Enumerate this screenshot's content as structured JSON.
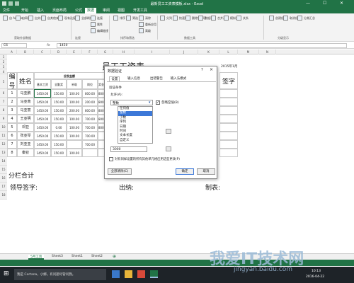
{
  "window": {
    "title": "最新员工工资表模板.xlsx - Excel"
  },
  "menu_tabs": [
    "文件",
    "开始",
    "插入",
    "页面布局",
    "公式",
    "数据",
    "审阅",
    "视图",
    "开发工具"
  ],
  "active_tab_index": 5,
  "ribbon": {
    "buttons": [
      "自 Access",
      "自网站",
      "自文本",
      "自其他来源",
      "现有连接",
      "全部刷新",
      "连接",
      "属性",
      "编辑链接",
      "排序",
      "筛选",
      "清除",
      "重新应用",
      "高级",
      "分列",
      "快速填充",
      "删除重复项",
      "数据验证",
      "合并计算",
      "模拟分析",
      "关系",
      "创建组",
      "取消组合",
      "分类汇总"
    ],
    "groups": [
      "获取外部数据",
      "连接",
      "排序和筛选",
      "数据工具",
      "分级显示"
    ]
  },
  "formula_bar": {
    "name_box": "C6",
    "fx": "fx",
    "value": "1450"
  },
  "columns": [
    "A",
    "B",
    "C",
    "D",
    "E",
    "F",
    "G",
    "H",
    "I",
    "J",
    "K",
    "L",
    "M",
    "N"
  ],
  "rows": [
    "1",
    "2",
    "3",
    "4",
    "5",
    "6",
    "7",
    "8",
    "9",
    "10",
    "11",
    "12",
    "13",
    "14",
    "15",
    "16",
    "17",
    "18"
  ],
  "sheet": {
    "title": "员工工资表",
    "date": "2015年1月",
    "header_num": "编号",
    "header_name": "姓名",
    "header_group": "应发金额",
    "header_sign": "签字",
    "sub_headers": [
      "基本工资",
      "全勤奖",
      "补助",
      "岗位",
      "奖金"
    ],
    "nums": [
      "1",
      "2",
      "3",
      "4",
      "5",
      "6",
      "7",
      "8"
    ],
    "names": [
      "马亚鹏",
      "马亚南",
      "马亚丽",
      "王亚明",
      "邓亚",
      "张亚琴",
      "刘亚亚",
      "秦亚"
    ],
    "rows": [
      [
        "1450.00",
        "150.00",
        "100.00",
        "800.00",
        "800.00"
      ],
      [
        "1450.00",
        "150.00",
        "100.00",
        "200.00",
        "800.00"
      ],
      [
        "1450.00",
        "150.00",
        "200.00",
        "800.00",
        "800.00"
      ],
      [
        "1450.00",
        "150.00",
        "100.00",
        "700.00",
        "800.00"
      ],
      [
        "1450.00",
        "0.00",
        "100.00",
        "700.00",
        "800.00"
      ],
      [
        "1450.00",
        "150.00",
        "100.00",
        "700.00",
        ""
      ],
      [
        "1450.00",
        "150.00",
        "",
        "700.00",
        ""
      ],
      [
        "1450.00",
        "150.00",
        "100.00",
        "",
        ""
      ]
    ],
    "subtotal": "分栏合计",
    "footer_leader": "领导签字:",
    "footer_cashier": "出纳:",
    "footer_maker": "制表:"
  },
  "dialog": {
    "title": "数据验证",
    "help": "?",
    "close": "×",
    "tabs": [
      "设置",
      "输入信息",
      "出错警告",
      "输入法模式"
    ],
    "section": "验证条件",
    "allow_label": "允许(A):",
    "allow_value": "整数",
    "ignore_blank": "忽略空值(B)",
    "options": [
      "任何值",
      "整数",
      "小数",
      "序列",
      "日期",
      "时间",
      "文本长度",
      "自定义"
    ],
    "selected_option": 1,
    "field_value": "3000",
    "apply_all": "对有同样设置的所有其他单元格应用这些更改(P)",
    "clear_all": "全部清除(C)",
    "ok": "确定",
    "cancel": "取消"
  },
  "sheet_tabs": [
    "5月工资",
    "Sheet3",
    "Sheet1",
    "Sheet2"
  ],
  "taskbar": {
    "search": "我是 Cortana，小娜。有问题尽管问我。",
    "time": "10:13",
    "date": "2016-04-22"
  },
  "watermark": {
    "line1": "我爱IT技术网",
    "line2": "jingyan.baidu.com"
  },
  "colors": {
    "excel_green": "#217346",
    "highlight": "#3c78d8"
  }
}
